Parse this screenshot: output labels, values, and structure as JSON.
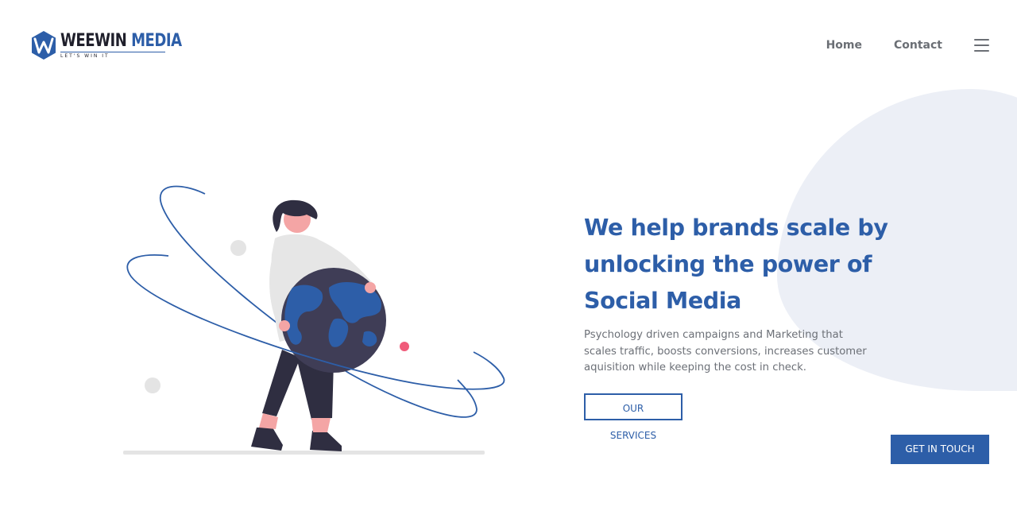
{
  "header": {
    "logo": {
      "word_a": "WEEWIN",
      "word_b": "MEDIA",
      "tagline": "LET'S WIN IT",
      "icon": "weewin-w-logo-icon"
    },
    "nav": {
      "items": [
        {
          "label": "Home"
        },
        {
          "label": "Contact"
        }
      ],
      "menu_icon": "hamburger-menu-icon"
    }
  },
  "hero": {
    "title": "We help brands scale by unlocking the power of Social Media",
    "subtitle": "Psychology driven campaigns and Marketing that scales traffic, boosts conversions, increases customer aquisition while keeping the cost in check.",
    "cta_services": "OUR SERVICES",
    "illustration": "woman-holding-globe-illustration"
  },
  "floating_cta": {
    "label": "GET IN TOUCH"
  },
  "colors": {
    "brand_blue": "#2d5ea8",
    "dark": "#1f1f2b",
    "nav_gray": "#6b6f75",
    "blob": "#eceff6",
    "accent_pink": "#f05b7a"
  }
}
